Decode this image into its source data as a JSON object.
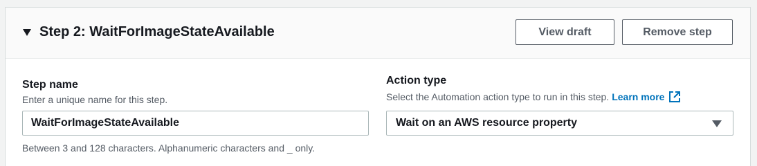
{
  "step": {
    "title": "Step 2: WaitForImageStateAvailable",
    "view_draft_label": "View draft",
    "remove_step_label": "Remove step"
  },
  "step_name": {
    "label": "Step name",
    "description": "Enter a unique name for this step.",
    "value": "WaitForImageStateAvailable",
    "constraint": "Between 3 and 128 characters. Alphanumeric characters and _ only."
  },
  "action_type": {
    "label": "Action type",
    "description": "Select the Automation action type to run in this step.",
    "learn_more": "Learn more",
    "selected": "Wait on an AWS resource property"
  },
  "icons": {
    "caret": "caret-down-icon",
    "external_link": "external-link-icon",
    "select_caret": "dropdown-caret-icon"
  },
  "colors": {
    "link": "#0073bb",
    "text": "#16191f",
    "muted": "#545b64",
    "border": "#aab7b8"
  }
}
